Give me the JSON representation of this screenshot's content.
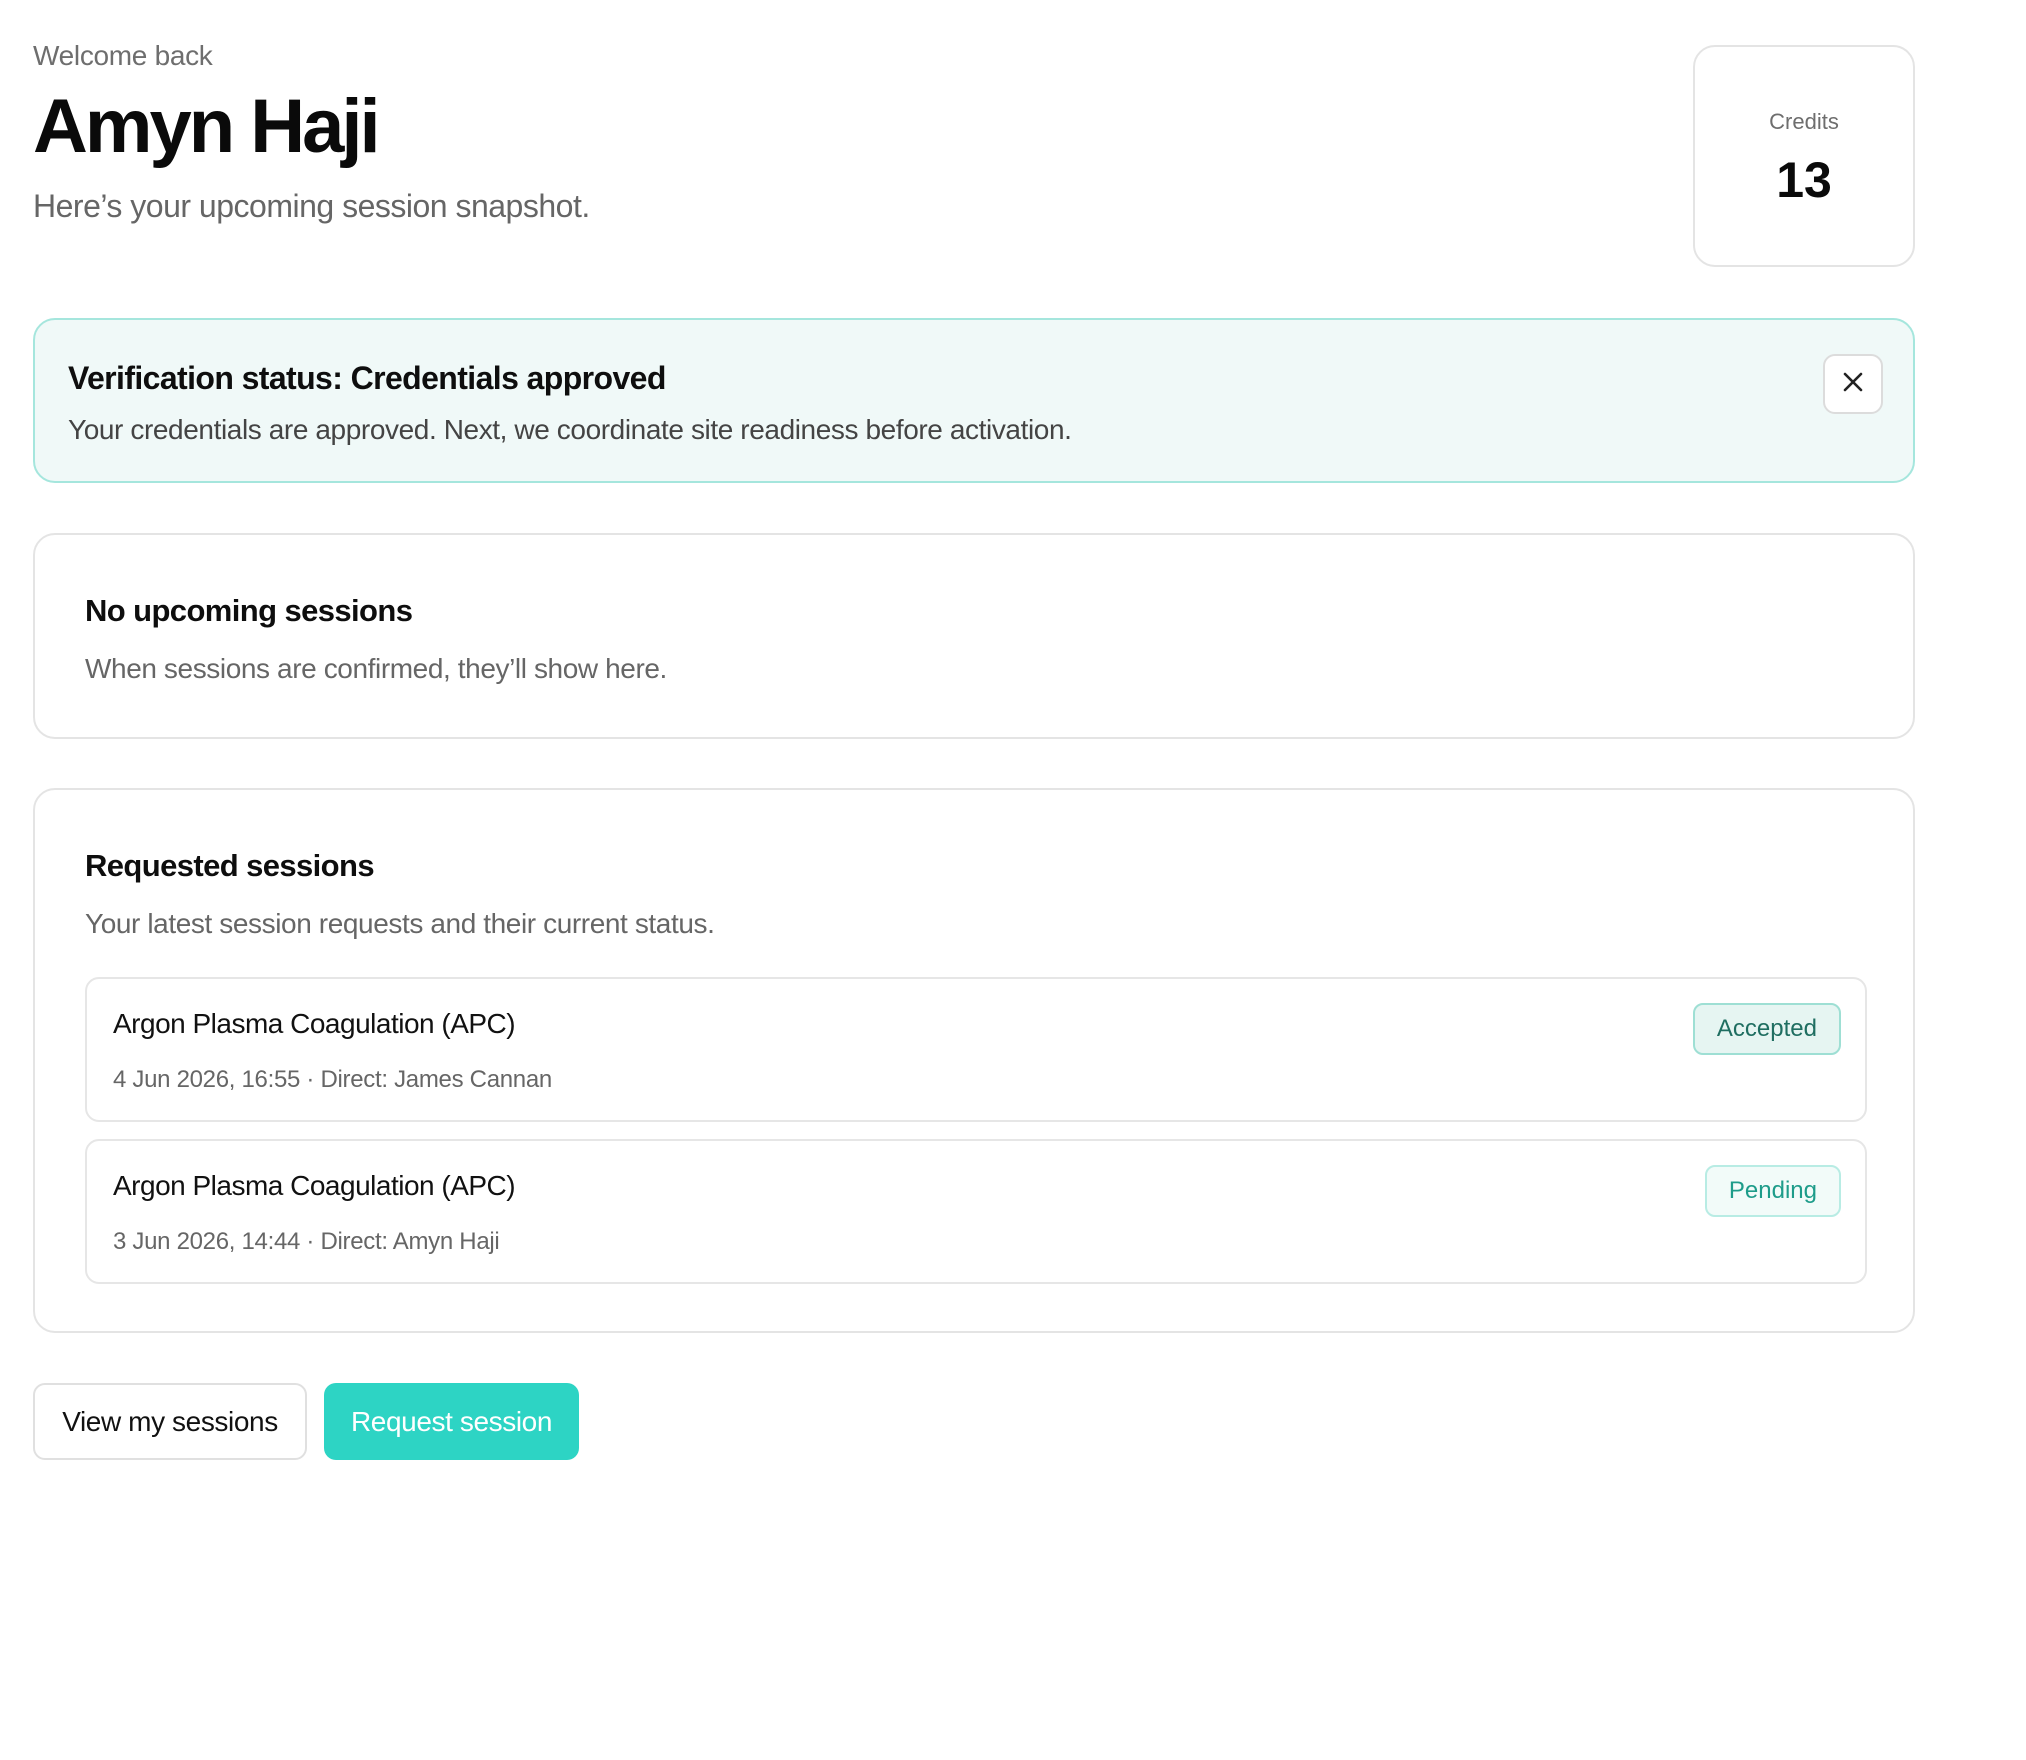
{
  "header": {
    "welcome": "Welcome back",
    "name": "Amyn Haji",
    "subtitle": "Here’s your upcoming session snapshot."
  },
  "credits": {
    "label": "Credits",
    "value": "13"
  },
  "verification": {
    "title": "Verification status: Credentials approved",
    "message": "Your credentials are approved. Next, we coordinate site readiness before activation.",
    "close_icon": "close-icon"
  },
  "upcoming": {
    "title": "No upcoming sessions",
    "description": "When sessions are confirmed, they’ll show here."
  },
  "requested": {
    "title": "Requested sessions",
    "description": "Your latest session requests and their current status.",
    "items": [
      {
        "name": "Argon Plasma Coagulation (APC)",
        "meta": "4 Jun 2026, 16:55 · Direct: James Cannan",
        "status": "Accepted"
      },
      {
        "name": "Argon Plasma Coagulation (APC)",
        "meta": "3 Jun 2026, 14:44 · Direct: Amyn Haji",
        "status": "Pending"
      }
    ]
  },
  "actions": {
    "view_sessions": "View my sessions",
    "request_session": "Request session"
  },
  "colors": {
    "accent": "#2dd4c4",
    "banner_bg": "#f0f9f8",
    "banner_border": "#a5e6dd",
    "accepted_text": "#1f6e61",
    "pending_text": "#1e9c8a"
  }
}
